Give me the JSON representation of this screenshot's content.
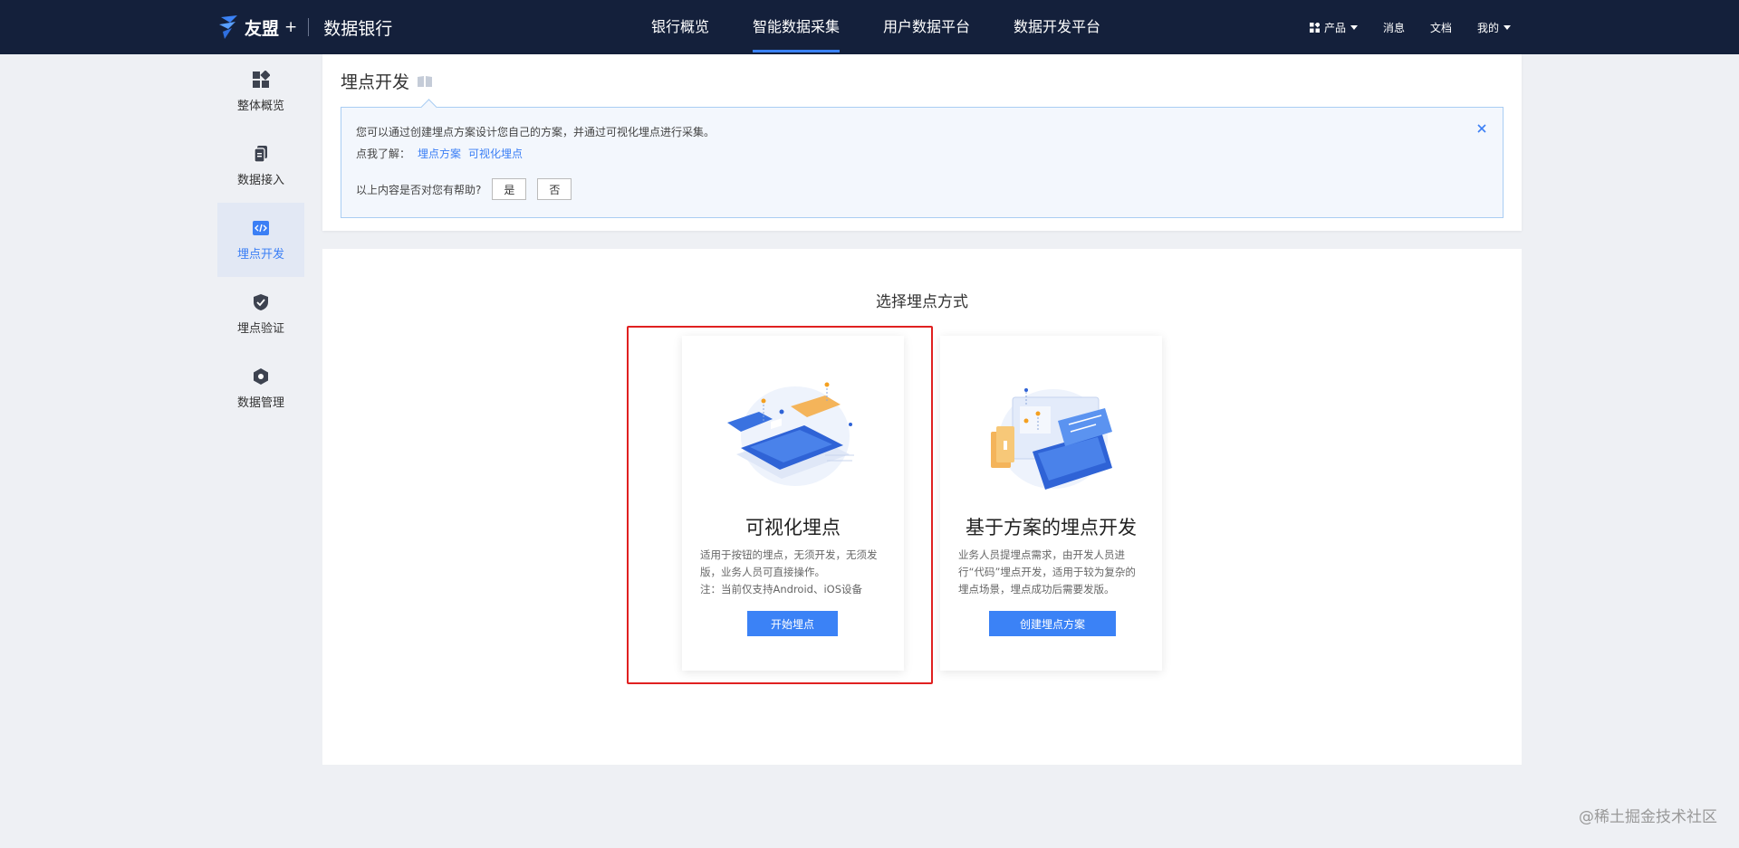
{
  "topbar": {
    "brand": "友盟",
    "brand_plus": "+",
    "product": "数据银行",
    "nav": [
      "银行概览",
      "智能数据采集",
      "用户数据平台",
      "数据开发平台"
    ],
    "nav_active": 1,
    "right": {
      "products": "产品",
      "messages": "消息",
      "docs": "文档",
      "mine": "我的"
    }
  },
  "sidebar": {
    "items": [
      {
        "label": "整体概览",
        "icon": "dashboard-icon"
      },
      {
        "label": "数据接入",
        "icon": "copy-document-icon"
      },
      {
        "label": "埋点开发",
        "icon": "code-icon",
        "active": true
      },
      {
        "label": "埋点验证",
        "icon": "shield-check-icon"
      },
      {
        "label": "数据管理",
        "icon": "hexagon-icon"
      }
    ]
  },
  "header": {
    "title": "埋点开发",
    "notice": {
      "line1": "您可以通过创建埋点方案设计您自己的方案，并通过可视化埋点进行采集。",
      "learn_prefix": "点我了解：",
      "links": [
        "埋点方案",
        "可视化埋点"
      ],
      "feedback_question": "以上内容是否对您有帮助?",
      "yes": "是",
      "no": "否"
    }
  },
  "main": {
    "section_title": "选择埋点方式",
    "cards": [
      {
        "title": "可视化埋点",
        "desc1": "适用于按钮的埋点，无须开发，无须发版，业务人员可直接操作。",
        "desc2": "注：当前仅支持Android、iOS设备",
        "button": "开始埋点"
      },
      {
        "title": "基于方案的埋点开发",
        "desc1": "业务人员提埋点需求，由开发人员进行“代码”埋点开发，适用于较为复杂的埋点场景，埋点成功后需要发版。",
        "button": "创建埋点方案"
      }
    ]
  },
  "watermark": "@稀土掘金技术社区",
  "colors": {
    "topbar": "#14203b",
    "accent": "#3b82f6",
    "highlight": "#e02020"
  }
}
